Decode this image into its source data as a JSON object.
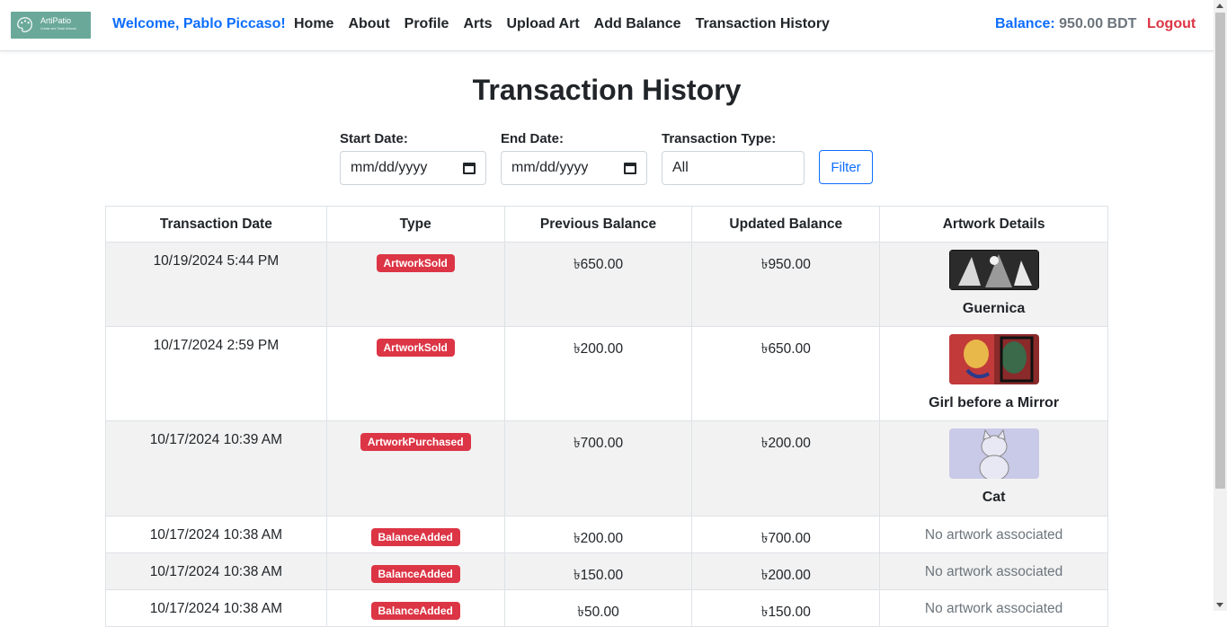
{
  "brand": {
    "name": "ArtiPatio",
    "tagline": "Create and Trade Artwork"
  },
  "nav": {
    "welcome": "Welcome, Pablo Piccaso!",
    "links": [
      "Home",
      "About",
      "Profile",
      "Arts",
      "Upload Art",
      "Add Balance",
      "Transaction History"
    ],
    "balance_label": "Balance:",
    "balance_value": "950.00 BDT",
    "logout": "Logout"
  },
  "page": {
    "title": "Transaction History"
  },
  "filters": {
    "start_label": "Start Date:",
    "start_placeholder": "mm/dd/yyyy",
    "end_label": "End Date:",
    "end_placeholder": "mm/dd/yyyy",
    "type_label": "Transaction Type:",
    "type_value": "All",
    "button": "Filter"
  },
  "table": {
    "headers": [
      "Transaction Date",
      "Type",
      "Previous Balance",
      "Updated Balance",
      "Artwork Details"
    ],
    "rows": [
      {
        "date": "10/19/2024 5:44 PM",
        "type": "ArtworkSold",
        "prev": "৳650.00",
        "updated": "৳950.00",
        "artwork": "Guernica"
      },
      {
        "date": "10/17/2024 2:59 PM",
        "type": "ArtworkSold",
        "prev": "৳200.00",
        "updated": "৳650.00",
        "artwork": "Girl before a Mirror"
      },
      {
        "date": "10/17/2024 10:39 AM",
        "type": "ArtworkPurchased",
        "prev": "৳700.00",
        "updated": "৳200.00",
        "artwork": "Cat"
      },
      {
        "date": "10/17/2024 10:38 AM",
        "type": "BalanceAdded",
        "prev": "৳200.00",
        "updated": "৳700.00",
        "artwork": "No artwork associated"
      },
      {
        "date": "10/17/2024 10:38 AM",
        "type": "BalanceAdded",
        "prev": "৳150.00",
        "updated": "৳200.00",
        "artwork": "No artwork associated"
      },
      {
        "date": "10/17/2024 10:38 AM",
        "type": "BalanceAdded",
        "prev": "৳50.00",
        "updated": "৳150.00",
        "artwork": "No artwork associated"
      }
    ]
  },
  "colors": {
    "primary": "#0d6efd",
    "danger": "#dc3545",
    "muted": "#6c757d",
    "brand": "#6aa89a"
  }
}
